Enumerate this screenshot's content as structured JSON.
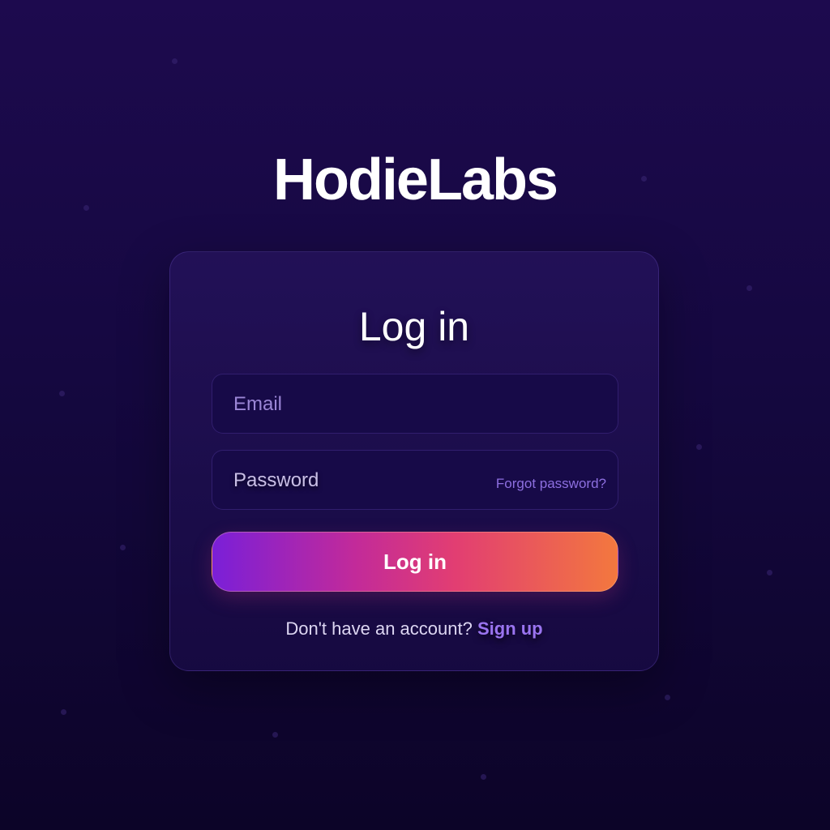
{
  "brand": {
    "name": "HodieLabs"
  },
  "login_form": {
    "title": "Log in",
    "email": {
      "placeholder": "Email",
      "value": ""
    },
    "password": {
      "placeholder": "Password",
      "value": ""
    },
    "forgot_password_label": "Forgot password?",
    "submit_label": "Log in",
    "signup_prompt": "Don't have an account?",
    "signup_link_label": "Sign up"
  },
  "colors": {
    "background_top": "#1d0a4e",
    "background_bottom": "#0c0428",
    "button_gradient_start": "#7a1fd8",
    "button_gradient_end": "#f3783e",
    "link_accent": "#9a74f0"
  }
}
